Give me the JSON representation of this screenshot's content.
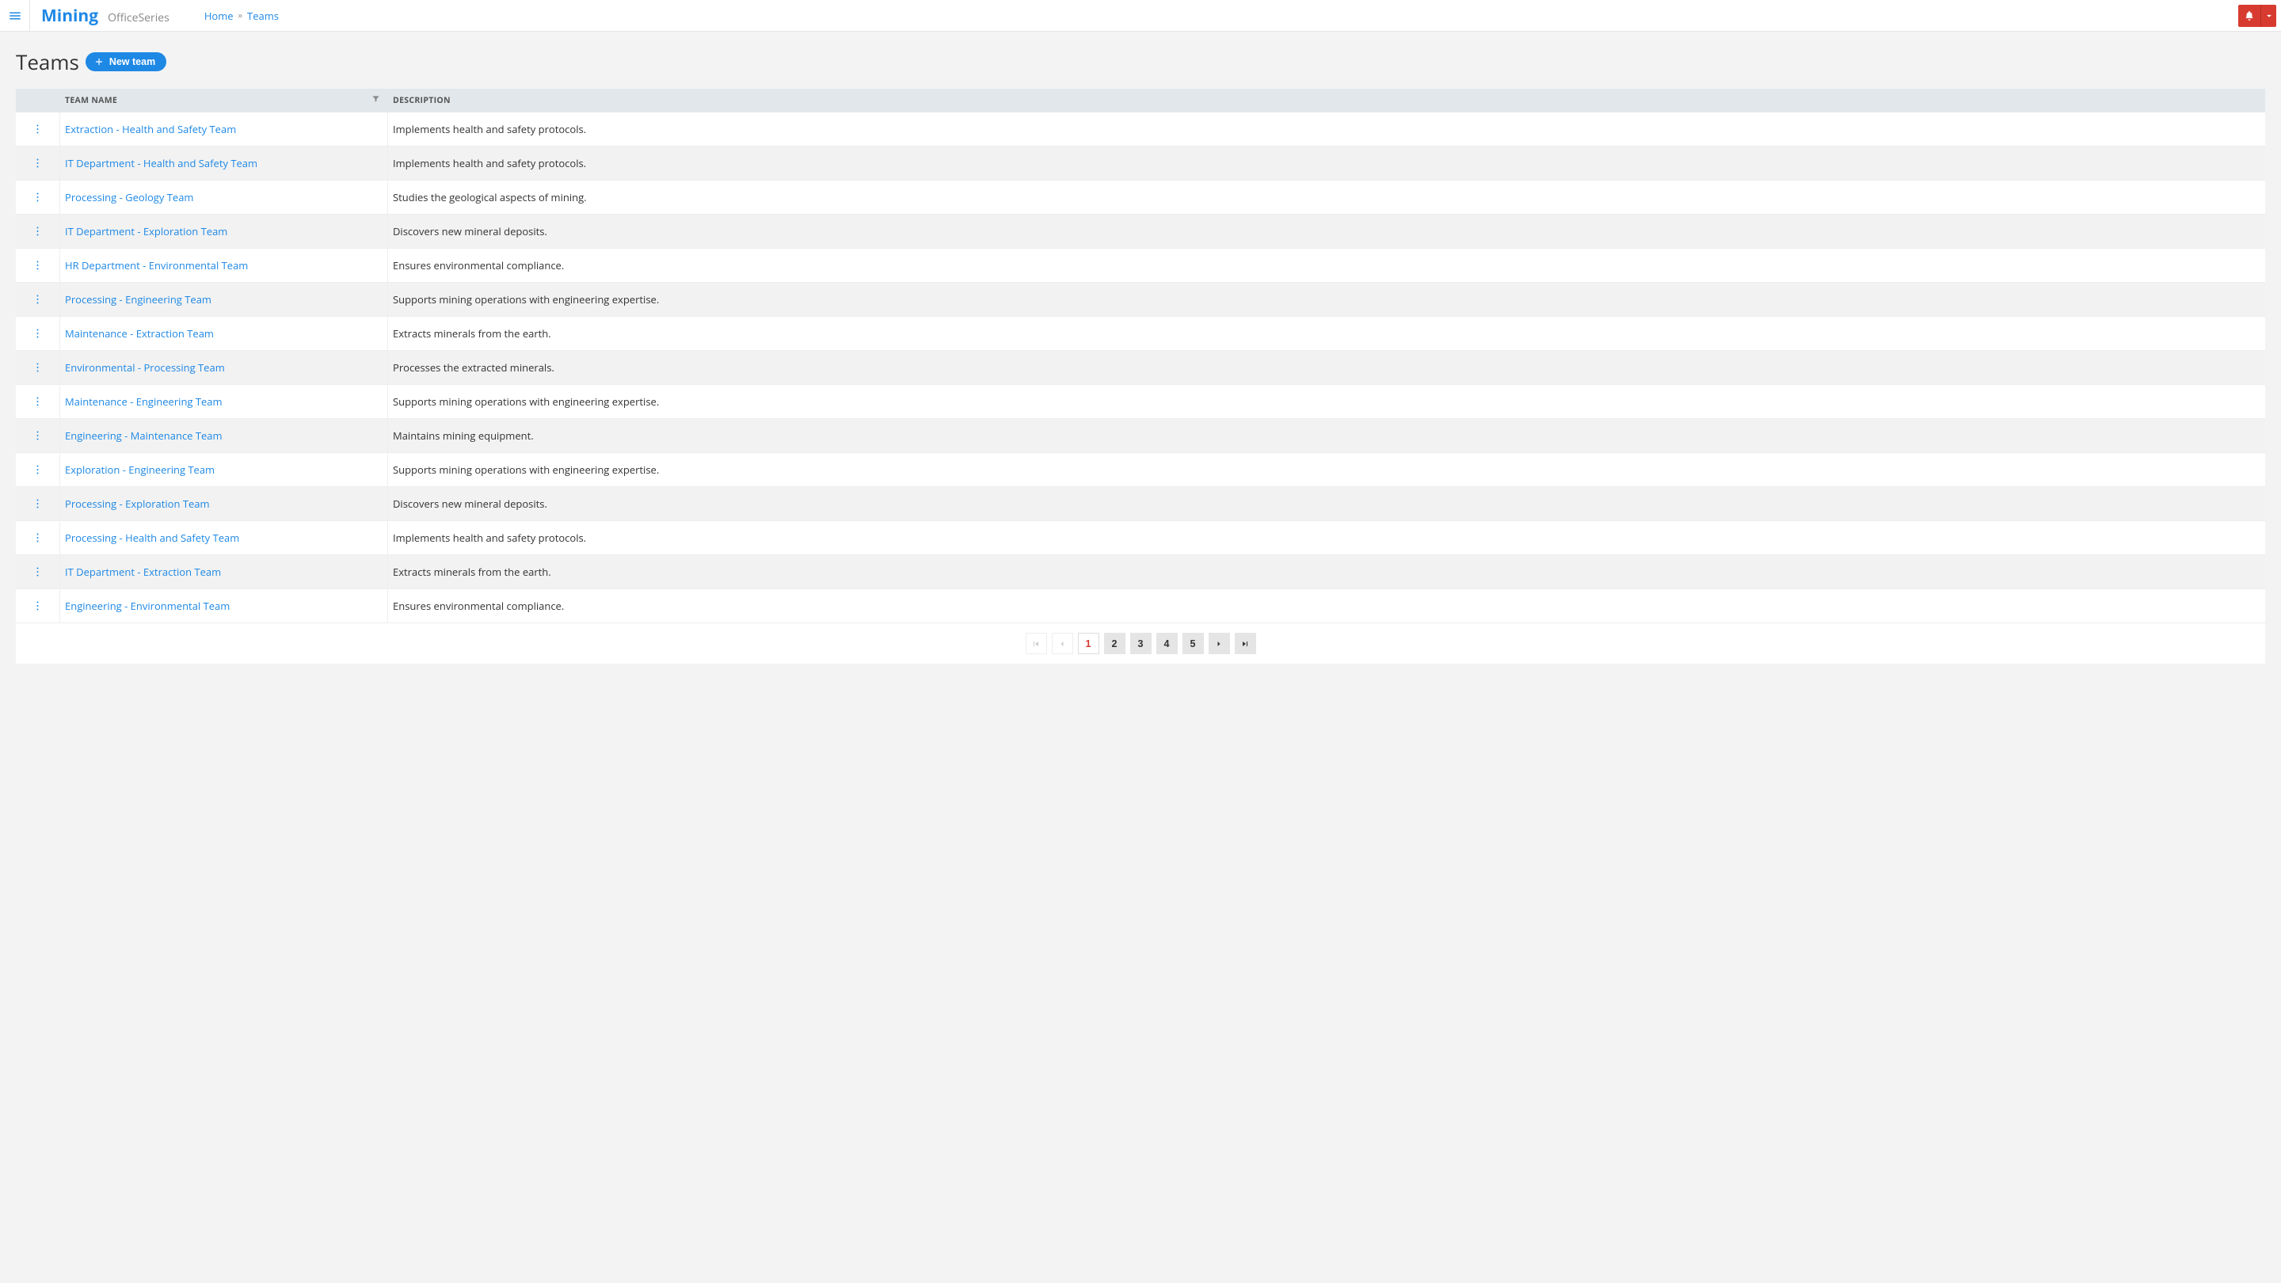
{
  "topbar": {
    "brand_main": "Mining",
    "brand_sub": "OfficeSeries"
  },
  "breadcrumb": {
    "home": "Home",
    "sep": "»",
    "current": "Teams"
  },
  "page": {
    "title": "Teams",
    "new_button": "New team"
  },
  "table": {
    "columns": {
      "name": "TEAM NAME",
      "description": "DESCRIPTION"
    },
    "rows": [
      {
        "name": "Extraction - Health and Safety Team",
        "description": "Implements health and safety protocols."
      },
      {
        "name": "IT Department - Health and Safety Team",
        "description": "Implements health and safety protocols."
      },
      {
        "name": "Processing - Geology Team",
        "description": "Studies the geological aspects of mining."
      },
      {
        "name": "IT Department - Exploration Team",
        "description": "Discovers new mineral deposits."
      },
      {
        "name": "HR Department - Environmental Team",
        "description": "Ensures environmental compliance."
      },
      {
        "name": "Processing - Engineering Team",
        "description": "Supports mining operations with engineering expertise."
      },
      {
        "name": "Maintenance - Extraction Team",
        "description": "Extracts minerals from the earth."
      },
      {
        "name": "Environmental - Processing Team",
        "description": "Processes the extracted minerals."
      },
      {
        "name": "Maintenance - Engineering Team",
        "description": "Supports mining operations with engineering expertise."
      },
      {
        "name": "Engineering - Maintenance Team",
        "description": "Maintains mining equipment."
      },
      {
        "name": "Exploration - Engineering Team",
        "description": "Supports mining operations with engineering expertise."
      },
      {
        "name": "Processing - Exploration Team",
        "description": "Discovers new mineral deposits."
      },
      {
        "name": "Processing - Health and Safety Team",
        "description": "Implements health and safety protocols."
      },
      {
        "name": "IT Department - Extraction Team",
        "description": "Extracts minerals from the earth."
      },
      {
        "name": "Engineering - Environmental Team",
        "description": "Ensures environmental compliance."
      }
    ]
  },
  "pagination": {
    "pages": [
      "1",
      "2",
      "3",
      "4",
      "5"
    ],
    "current": "1"
  }
}
